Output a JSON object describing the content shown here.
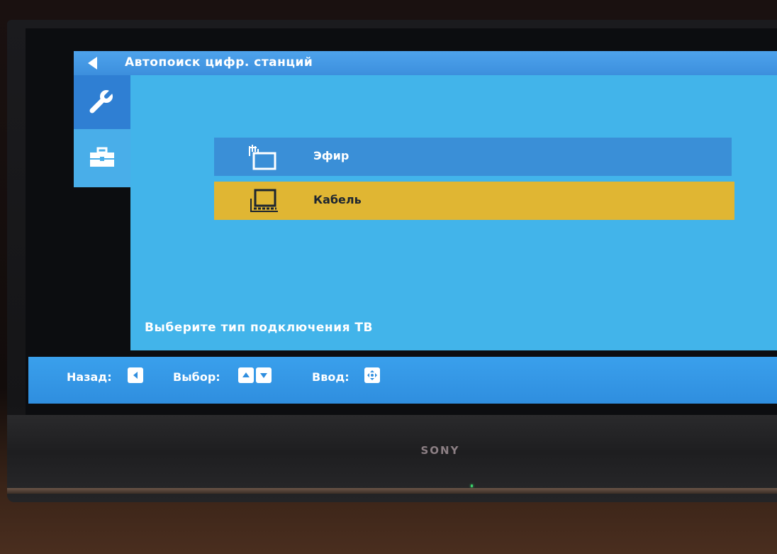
{
  "title": "Автопоиск цифр. станций",
  "options": [
    {
      "label": "Эфир",
      "icon": "antenna-tv-icon",
      "state": "default"
    },
    {
      "label": "Кабель",
      "icon": "cable-tv-icon",
      "state": "selected"
    }
  ],
  "hint": "Выберите тип подключения ТВ",
  "help": {
    "back_label": "Назад:",
    "select_label": "Выбор:",
    "enter_label": "Ввод:"
  },
  "sidebar": {
    "items": [
      {
        "icon": "wrench-icon",
        "state": "active"
      },
      {
        "icon": "toolbox-icon",
        "state": "inactive"
      }
    ]
  },
  "brand": "SONY",
  "colors": {
    "accent": "#3a8fd7",
    "panel": "#42b4ea",
    "selected": "#e0b633",
    "bar": "#2f8edf"
  }
}
